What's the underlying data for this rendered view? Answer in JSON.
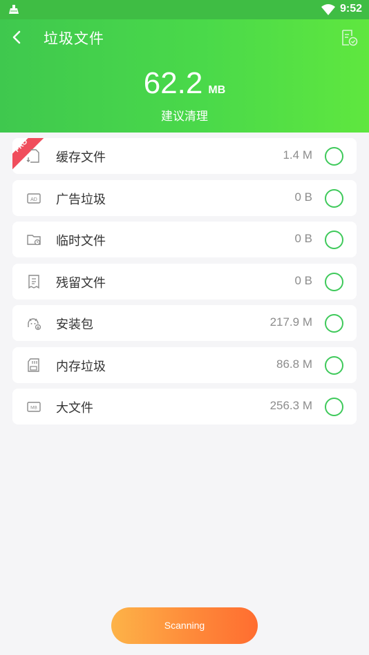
{
  "status_bar": {
    "time": "9:52"
  },
  "header": {
    "title": "垃圾文件",
    "total_value": "62.2",
    "total_unit": "MB",
    "suggestion": "建议清理"
  },
  "items": [
    {
      "label": "缓存文件",
      "size": "1.4 M",
      "icon": "cache-file-icon",
      "pro": "PRO"
    },
    {
      "label": "广告垃圾",
      "size": "0 B",
      "icon": "ad-icon"
    },
    {
      "label": "临时文件",
      "size": "0 B",
      "icon": "temp-folder-icon"
    },
    {
      "label": "残留文件",
      "size": "0 B",
      "icon": "residual-file-icon"
    },
    {
      "label": "安装包",
      "size": "217.9 M",
      "icon": "android-package-icon"
    },
    {
      "label": "内存垃圾",
      "size": "86.8 M",
      "icon": "sd-card-icon"
    },
    {
      "label": "大文件",
      "size": "256.3 M",
      "icon": "mb-file-icon"
    }
  ],
  "scan_button": {
    "label": "Scanning"
  },
  "colors": {
    "header_green": "#4ad94a",
    "check_green": "#3ec95a",
    "pro_red": "#f04d5c",
    "button_orange": "#fe8a3a"
  }
}
